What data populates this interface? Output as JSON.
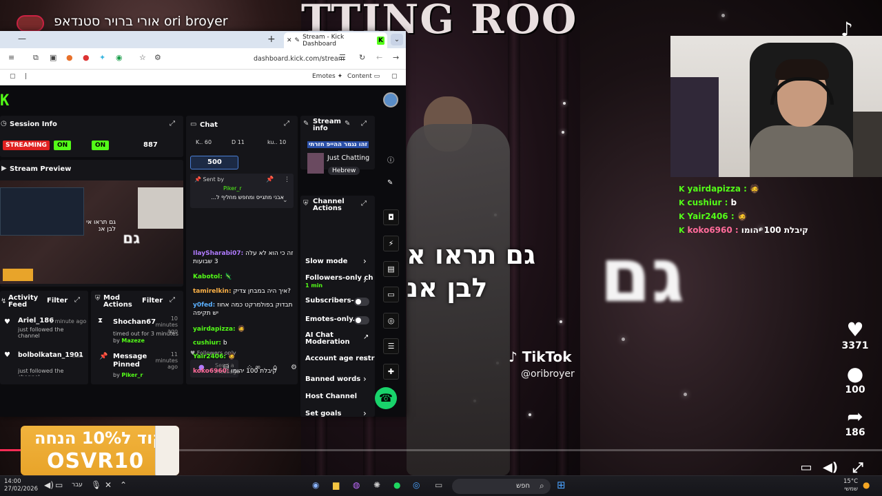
{
  "overlay": {
    "top_title": "אורי ברויר סטנדאפ ori broyer",
    "caption_line1": "גם תראו א",
    "caption_line2": "לבן אנ",
    "big_text": "גם",
    "tiktok_brand": "TikTok",
    "tiktok_handle": "@oribroyer",
    "room_sign": "TTING ROO",
    "likes": "3371",
    "comments": "100",
    "shares": "186",
    "progress_fraction": 0.03
  },
  "right_chat": [
    {
      "user": "yairdapizza :",
      "text": "",
      "color": "#53fc18"
    },
    {
      "user": "cushiur :",
      "text": "b",
      "color": "#53fc18"
    },
    {
      "user": "Yair2406 :",
      "text": "",
      "color": "#53fc18"
    },
    {
      "user": "koko6960 :",
      "text": "קיבלת 100 יהומו",
      "color": "#ff6b9a"
    }
  ],
  "browser": {
    "tab_title": "Stream - Kick Dashboard",
    "address": "dashboard.kick.com/stream",
    "bookmarks": {
      "emotes": "Emotes",
      "content": "Content"
    }
  },
  "kick": {
    "logo": "K",
    "session_info": {
      "title": "Session Info",
      "status": "STREAMING",
      "toggle1": "ON",
      "toggle2": "ON",
      "viewers": "887"
    },
    "stream_preview": {
      "title": "Stream Preview",
      "caption": "גם תראו אי לבן אנ",
      "big": "גם"
    },
    "chat": {
      "title": "Chat",
      "stats": [
        "K.. 60",
        "D 11",
        "ku.. 10"
      ],
      "goal": "500",
      "pinned_label": "Sent by",
      "pinned_user": "Piker_r",
      "pinned_text": "אבני מתגייס ומחפש מחליף ל...",
      "messages": [
        {
          "user": "IlaySharabi07:",
          "text": "זה כי הוא לא עלה 3 שבועות",
          "color": "#b07bff"
        },
        {
          "user": "Kabotol:",
          "text": "",
          "color": "#53fc18"
        },
        {
          "user": "tamirelkin:",
          "text": "איך היה במבחן צדיק?",
          "color": "#ffb347"
        },
        {
          "user": "y0fed:",
          "text": "תבדוק בפולמרקט כמה אחוז יש תקיפה",
          "color": "#5ab0ff"
        },
        {
          "user": "yairdapizza:",
          "text": "",
          "color": "#53fc18"
        },
        {
          "user": "cushiur:",
          "text": "b",
          "color": "#53fc18"
        },
        {
          "user": "Yair2406:",
          "text": "",
          "color": "#53fc18"
        },
        {
          "user": "koko6960:",
          "text": "קיבלת 100 יהומו",
          "color": "#ff6b9a"
        }
      ],
      "followers_only": "Followers only",
      "input_placeholder": "Send a message"
    },
    "stream_info": {
      "title": "Stream info",
      "stream_title": "זהו נגמר ההייפ חזרתי",
      "category": "Just Chatting",
      "language": "Hebrew"
    },
    "channel_actions": {
      "title": "Channel Actions",
      "items": [
        {
          "label": "Slow mode",
          "kind": "arrow"
        },
        {
          "label": "Followers-only ch",
          "sub": "1 min",
          "kind": "arrow"
        },
        {
          "label": "Subscribers-...",
          "kind": "toggle"
        },
        {
          "label": "Emotes-only...",
          "kind": "toggle"
        },
        {
          "label": "AI Chat Moderation",
          "kind": "ext"
        },
        {
          "label": "Account age restr",
          "kind": "arrow"
        },
        {
          "label": "Banned words",
          "kind": "arrow"
        },
        {
          "label": "Host Channel",
          "kind": "none"
        },
        {
          "label": "Set goals",
          "kind": "arrow"
        }
      ]
    },
    "activity_feed": {
      "title": "Activity Feed",
      "filter": "Filter",
      "items": [
        {
          "user": "Ariel_186",
          "time": "1 minute ago",
          "text": "just followed the channel"
        },
        {
          "user": "bolbolkatan_1901",
          "time": "min",
          "text": "just followed the channel"
        }
      ]
    },
    "mod_actions": {
      "title": "Mod Actions",
      "filter": "Filter",
      "items": [
        {
          "user": "Shochan67",
          "time": "10 minutes ago",
          "text": "timed out for 3 minutes",
          "by": "Mazeze"
        },
        {
          "user": "Message Pinned",
          "time": "11 minutes ago",
          "text": "",
          "by": "Piker_r"
        }
      ]
    }
  },
  "promo": {
    "line1": "קוד ל10% הנחה",
    "line2": "OSVR10"
  },
  "taskbar": {
    "time": "14:00",
    "date": "27/02/2026",
    "lang": "עבר",
    "search": "חפש",
    "temp": "15°C",
    "weather": "שמשי"
  }
}
